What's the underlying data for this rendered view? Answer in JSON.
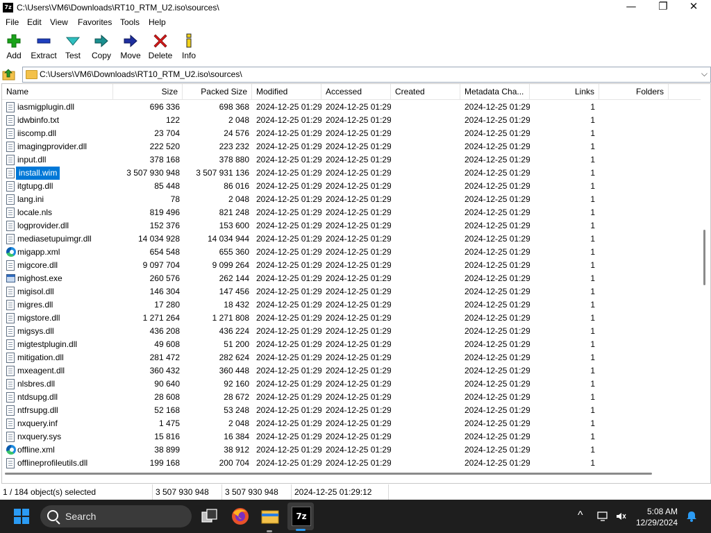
{
  "window": {
    "icon_text": "7z",
    "title": "C:\\Users\\VM6\\Downloads\\RT10_RTM_U2.iso\\sources\\",
    "minimize_glyph": "—",
    "maximize_glyph": "❐",
    "close_glyph": "✕"
  },
  "menu": [
    "File",
    "Edit",
    "View",
    "Favorites",
    "Tools",
    "Help"
  ],
  "toolbar": [
    {
      "label": "Add",
      "icon": "plus-icon",
      "color": "#1aa31a"
    },
    {
      "label": "Extract",
      "icon": "minus-icon",
      "color": "#1f3fbf"
    },
    {
      "label": "Test",
      "icon": "check-icon",
      "color": "#2fbfbf"
    },
    {
      "label": "Copy",
      "icon": "copy-arrow-icon",
      "color": "#1a8f8f"
    },
    {
      "label": "Move",
      "icon": "move-arrow-icon",
      "color": "#1f2f9f"
    },
    {
      "label": "Delete",
      "icon": "delete-x-icon",
      "color": "#d81b1b"
    },
    {
      "label": "Info",
      "icon": "info-icon",
      "color": "#2a2a2a"
    }
  ],
  "address": {
    "path": "C:\\Users\\VM6\\Downloads\\RT10_RTM_U2.iso\\sources\\",
    "chevron": "⌵"
  },
  "columns": [
    "Name",
    "Size",
    "Packed Size",
    "Modified",
    "Accessed",
    "Created",
    "Metadata Cha...",
    "Links",
    "Folders"
  ],
  "files": [
    {
      "name": "iasmigplugin.dll",
      "size": "696 336",
      "packed": "698 368",
      "modified": "2024-12-25 01:29",
      "accessed": "2024-12-25 01:29",
      "created": "",
      "metadata": "2024-12-25 01:29",
      "links": "1",
      "icon": "doc"
    },
    {
      "name": "idwbinfo.txt",
      "size": "122",
      "packed": "2 048",
      "modified": "2024-12-25 01:29",
      "accessed": "2024-12-25 01:29",
      "created": "",
      "metadata": "2024-12-25 01:29",
      "links": "1",
      "icon": "doc"
    },
    {
      "name": "iiscomp.dll",
      "size": "23 704",
      "packed": "24 576",
      "modified": "2024-12-25 01:29",
      "accessed": "2024-12-25 01:29",
      "created": "",
      "metadata": "2024-12-25 01:29",
      "links": "1",
      "icon": "doc"
    },
    {
      "name": "imagingprovider.dll",
      "size": "222 520",
      "packed": "223 232",
      "modified": "2024-12-25 01:29",
      "accessed": "2024-12-25 01:29",
      "created": "",
      "metadata": "2024-12-25 01:29",
      "links": "1",
      "icon": "doc"
    },
    {
      "name": "input.dll",
      "size": "378 168",
      "packed": "378 880",
      "modified": "2024-12-25 01:29",
      "accessed": "2024-12-25 01:29",
      "created": "",
      "metadata": "2024-12-25 01:29",
      "links": "1",
      "icon": "doc"
    },
    {
      "name": "install.wim",
      "size": "3 507 930 948",
      "packed": "3 507 931 136",
      "modified": "2024-12-25 01:29",
      "accessed": "2024-12-25 01:29",
      "created": "",
      "metadata": "2024-12-25 01:29",
      "links": "1",
      "icon": "doc",
      "selected": true
    },
    {
      "name": "itgtupg.dll",
      "size": "85 448",
      "packed": "86 016",
      "modified": "2024-12-25 01:29",
      "accessed": "2024-12-25 01:29",
      "created": "",
      "metadata": "2024-12-25 01:29",
      "links": "1",
      "icon": "doc"
    },
    {
      "name": "lang.ini",
      "size": "78",
      "packed": "2 048",
      "modified": "2024-12-25 01:29",
      "accessed": "2024-12-25 01:29",
      "created": "",
      "metadata": "2024-12-25 01:29",
      "links": "1",
      "icon": "doc"
    },
    {
      "name": "locale.nls",
      "size": "819 496",
      "packed": "821 248",
      "modified": "2024-12-25 01:29",
      "accessed": "2024-12-25 01:29",
      "created": "",
      "metadata": "2024-12-25 01:29",
      "links": "1",
      "icon": "doc"
    },
    {
      "name": "logprovider.dll",
      "size": "152 376",
      "packed": "153 600",
      "modified": "2024-12-25 01:29",
      "accessed": "2024-12-25 01:29",
      "created": "",
      "metadata": "2024-12-25 01:29",
      "links": "1",
      "icon": "doc"
    },
    {
      "name": "mediasetupuimgr.dll",
      "size": "14 034 928",
      "packed": "14 034 944",
      "modified": "2024-12-25 01:29",
      "accessed": "2024-12-25 01:29",
      "created": "",
      "metadata": "2024-12-25 01:29",
      "links": "1",
      "icon": "doc"
    },
    {
      "name": "migapp.xml",
      "size": "654 548",
      "packed": "655 360",
      "modified": "2024-12-25 01:29",
      "accessed": "2024-12-25 01:29",
      "created": "",
      "metadata": "2024-12-25 01:29",
      "links": "1",
      "icon": "edge"
    },
    {
      "name": "migcore.dll",
      "size": "9 097 704",
      "packed": "9 099 264",
      "modified": "2024-12-25 01:29",
      "accessed": "2024-12-25 01:29",
      "created": "",
      "metadata": "2024-12-25 01:29",
      "links": "1",
      "icon": "doc"
    },
    {
      "name": "mighost.exe",
      "size": "260 576",
      "packed": "262 144",
      "modified": "2024-12-25 01:29",
      "accessed": "2024-12-25 01:29",
      "created": "",
      "metadata": "2024-12-25 01:29",
      "links": "1",
      "icon": "exe"
    },
    {
      "name": "migisol.dll",
      "size": "146 304",
      "packed": "147 456",
      "modified": "2024-12-25 01:29",
      "accessed": "2024-12-25 01:29",
      "created": "",
      "metadata": "2024-12-25 01:29",
      "links": "1",
      "icon": "doc"
    },
    {
      "name": "migres.dll",
      "size": "17 280",
      "packed": "18 432",
      "modified": "2024-12-25 01:29",
      "accessed": "2024-12-25 01:29",
      "created": "",
      "metadata": "2024-12-25 01:29",
      "links": "1",
      "icon": "doc"
    },
    {
      "name": "migstore.dll",
      "size": "1 271 264",
      "packed": "1 271 808",
      "modified": "2024-12-25 01:29",
      "accessed": "2024-12-25 01:29",
      "created": "",
      "metadata": "2024-12-25 01:29",
      "links": "1",
      "icon": "doc"
    },
    {
      "name": "migsys.dll",
      "size": "436 208",
      "packed": "436 224",
      "modified": "2024-12-25 01:29",
      "accessed": "2024-12-25 01:29",
      "created": "",
      "metadata": "2024-12-25 01:29",
      "links": "1",
      "icon": "doc"
    },
    {
      "name": "migtestplugin.dll",
      "size": "49 608",
      "packed": "51 200",
      "modified": "2024-12-25 01:29",
      "accessed": "2024-12-25 01:29",
      "created": "",
      "metadata": "2024-12-25 01:29",
      "links": "1",
      "icon": "doc"
    },
    {
      "name": "mitigation.dll",
      "size": "281 472",
      "packed": "282 624",
      "modified": "2024-12-25 01:29",
      "accessed": "2024-12-25 01:29",
      "created": "",
      "metadata": "2024-12-25 01:29",
      "links": "1",
      "icon": "doc"
    },
    {
      "name": "mxeagent.dll",
      "size": "360 432",
      "packed": "360 448",
      "modified": "2024-12-25 01:29",
      "accessed": "2024-12-25 01:29",
      "created": "",
      "metadata": "2024-12-25 01:29",
      "links": "1",
      "icon": "doc"
    },
    {
      "name": "nlsbres.dll",
      "size": "90 640",
      "packed": "92 160",
      "modified": "2024-12-25 01:29",
      "accessed": "2024-12-25 01:29",
      "created": "",
      "metadata": "2024-12-25 01:29",
      "links": "1",
      "icon": "doc"
    },
    {
      "name": "ntdsupg.dll",
      "size": "28 608",
      "packed": "28 672",
      "modified": "2024-12-25 01:29",
      "accessed": "2024-12-25 01:29",
      "created": "",
      "metadata": "2024-12-25 01:29",
      "links": "1",
      "icon": "doc"
    },
    {
      "name": "ntfrsupg.dll",
      "size": "52 168",
      "packed": "53 248",
      "modified": "2024-12-25 01:29",
      "accessed": "2024-12-25 01:29",
      "created": "",
      "metadata": "2024-12-25 01:29",
      "links": "1",
      "icon": "doc"
    },
    {
      "name": "nxquery.inf",
      "size": "1 475",
      "packed": "2 048",
      "modified": "2024-12-25 01:29",
      "accessed": "2024-12-25 01:29",
      "created": "",
      "metadata": "2024-12-25 01:29",
      "links": "1",
      "icon": "doc"
    },
    {
      "name": "nxquery.sys",
      "size": "15 816",
      "packed": "16 384",
      "modified": "2024-12-25 01:29",
      "accessed": "2024-12-25 01:29",
      "created": "",
      "metadata": "2024-12-25 01:29",
      "links": "1",
      "icon": "doc"
    },
    {
      "name": "offline.xml",
      "size": "38 899",
      "packed": "38 912",
      "modified": "2024-12-25 01:29",
      "accessed": "2024-12-25 01:29",
      "created": "",
      "metadata": "2024-12-25 01:29",
      "links": "1",
      "icon": "edge"
    },
    {
      "name": "offlineprofileutils.dll",
      "size": "199 168",
      "packed": "200 704",
      "modified": "2024-12-25 01:29",
      "accessed": "2024-12-25 01:29",
      "created": "",
      "metadata": "2024-12-25 01:29",
      "links": "1",
      "icon": "doc"
    }
  ],
  "status": {
    "selection": "1 / 184 object(s) selected",
    "size": "3 507 930 948",
    "packed": "3 507 930 948",
    "modified": "2024-12-25 01:29:12"
  },
  "taskbar": {
    "search_placeholder": "Search",
    "tray_chevron": "^",
    "time": "5:08 AM",
    "date": "12/29/2024",
    "apps": [
      {
        "name": "task-view-icon",
        "active": false
      },
      {
        "name": "firefox-icon",
        "active": false
      },
      {
        "name": "file-explorer-icon",
        "active": false
      },
      {
        "name": "7zip-icon",
        "label": "7z",
        "active": true
      }
    ]
  },
  "colors": {
    "selection": "#0078d7",
    "taskbar": "#1e1e1e",
    "accent": "#2b9bf4"
  }
}
